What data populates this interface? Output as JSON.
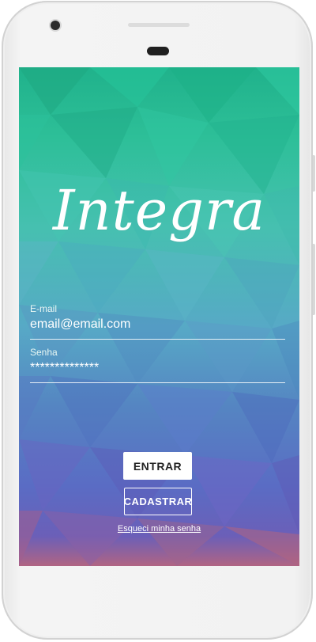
{
  "app": {
    "logo_text": "Integra"
  },
  "form": {
    "email": {
      "label": "E-mail",
      "value": "email@email.com"
    },
    "password": {
      "label": "Senha",
      "value": "**************"
    }
  },
  "actions": {
    "login_label": "ENTRAR",
    "register_label": "CADASTRAR",
    "forgot_label": "Esqueci minha senha"
  },
  "colors": {
    "top": "#20b28b",
    "middle": "#57a9c6",
    "bottom": "#6b5fb8",
    "button_bg": "#ffffff"
  }
}
